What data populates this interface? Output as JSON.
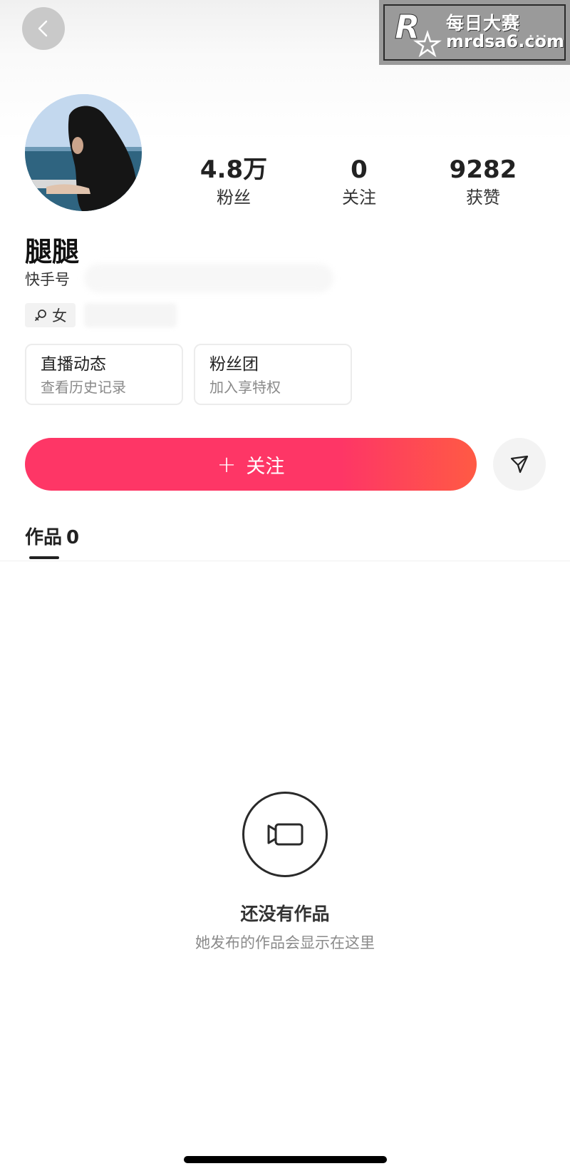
{
  "watermark": {
    "logo_letter": "R",
    "logo_small": "每日大赛",
    "name": "每日大赛",
    "url": "mrdsa6.com",
    "dots": "..."
  },
  "profile": {
    "name": "腿腿",
    "id_label": "快手号",
    "gender": "女"
  },
  "stats": [
    {
      "value": "4.8万",
      "label": "粉丝"
    },
    {
      "value": "0",
      "label": "关注"
    },
    {
      "value": "9282",
      "label": "获赞"
    }
  ],
  "cards": [
    {
      "title": "直播动态",
      "subtitle": "查看历史记录"
    },
    {
      "title": "粉丝团",
      "subtitle": "加入享特权"
    }
  ],
  "actions": {
    "follow_plus": "+",
    "follow_label": "关注"
  },
  "tabs": {
    "works_label": "作品",
    "works_count": "0"
  },
  "empty_state": {
    "title": "还没有作品",
    "subtitle": "她发布的作品会显示在这里"
  },
  "colors": {
    "follow_start": "#fe3666",
    "follow_end": "#ff5a44"
  }
}
